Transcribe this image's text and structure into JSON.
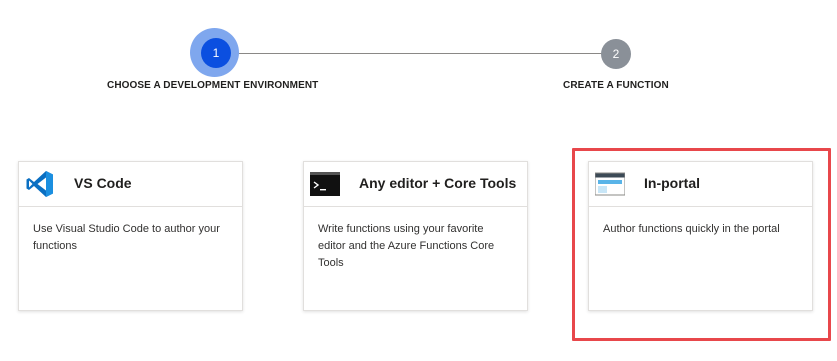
{
  "stepper": {
    "steps": [
      {
        "number": "1",
        "label": "CHOOSE A DEVELOPMENT ENVIRONMENT",
        "state": "active"
      },
      {
        "number": "2",
        "label": "CREATE A FUNCTION",
        "state": "inactive"
      }
    ]
  },
  "cards": [
    {
      "title": "VS Code",
      "icon": "vscode-icon",
      "description": "Use Visual Studio Code to author your functions"
    },
    {
      "title": "Any editor + Core Tools",
      "icon": "terminal-icon",
      "description": "Write functions using your favorite editor and the Azure Functions Core Tools"
    },
    {
      "title": "In-portal",
      "icon": "portal-window-icon",
      "description": "Author functions quickly in the portal",
      "highlighted": true
    }
  ],
  "colors": {
    "active_step": "#0b4fe0",
    "inactive_step": "#8a9098",
    "highlight_border": "#e8474b",
    "vscode_blue": "#0078d4"
  }
}
